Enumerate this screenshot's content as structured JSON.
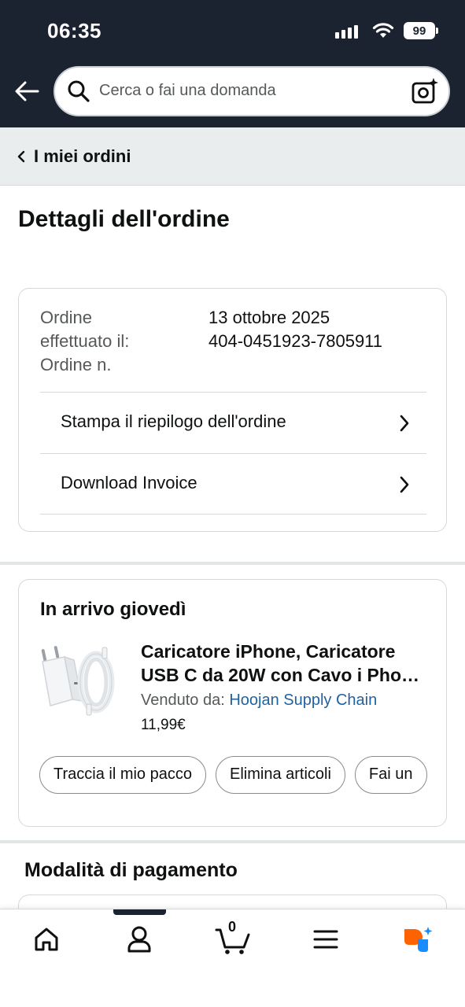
{
  "status_bar": {
    "time": "06:35",
    "battery": "99"
  },
  "header": {
    "search_placeholder": "Cerca o fai una domanda"
  },
  "breadcrumb": {
    "label": "I miei ordini"
  },
  "page": {
    "title": "Dettagli dell'ordine"
  },
  "order_info": {
    "labels": "Ordine effettuato il: Ordine n.",
    "label_line1": "Ordine",
    "label_line2": "effettuato il:",
    "label_line3": "Ordine n.",
    "date": "13 ottobre 2025",
    "number": "404-0451923-7805911"
  },
  "actions": {
    "print_summary": "Stampa il riepilogo dell'ordine",
    "download_invoice": "Download Invoice"
  },
  "delivery": {
    "title": "In arrivo giovedì",
    "product_name": "Caricatore iPhone, Caricatore USB C da 20W con Cavo i Pho…",
    "product_line1": "Caricatore iPhone, Caricatore",
    "product_line2": "USB C da 20W con Cavo i Pho…",
    "sold_by_label": "Venduto da:",
    "seller": "Hoojan Supply Chain",
    "price": "11,99€",
    "buttons": [
      "Traccia il mio pacco",
      "Elimina articoli",
      "Fai un"
    ]
  },
  "payment": {
    "title": "Modalità di pagamento"
  },
  "bottom_nav": {
    "cart_count": "0",
    "items": [
      "home-icon",
      "account-icon",
      "cart-icon",
      "menu-icon",
      "ai-assistant-icon"
    ]
  },
  "colors": {
    "header_bg": "#1b2230",
    "link": "#2162a1",
    "border": "#d5d9d9",
    "breadcrumb_bg": "#eaeded",
    "ai_orange": "#ff6200",
    "ai_blue": "#1a8cff"
  }
}
